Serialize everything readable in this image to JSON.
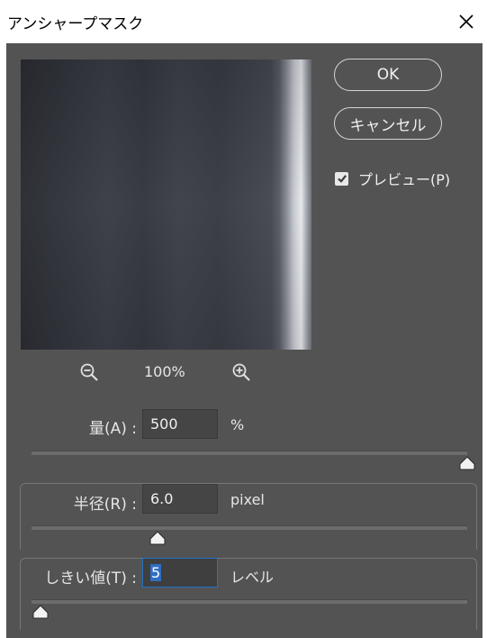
{
  "window": {
    "title": "アンシャープマスク"
  },
  "buttons": {
    "ok": "OK",
    "cancel": "キャンセル"
  },
  "preview_option": {
    "label": "プレビュー(P)",
    "checked": true
  },
  "zoom": {
    "level": "100%"
  },
  "amount": {
    "label": "量(A) :",
    "value": "500",
    "unit": "%",
    "slider_fraction": 1.0
  },
  "radius": {
    "label": "半径(R) :",
    "value": "6.0",
    "unit": "pixel",
    "slider_fraction": 0.29
  },
  "threshold": {
    "label": "しきい値(T) :",
    "value": "5",
    "unit": "レベル",
    "slider_fraction": 0.02
  },
  "colors": {
    "dialog_bg": "#535353",
    "focus_border": "#1e73c8"
  }
}
